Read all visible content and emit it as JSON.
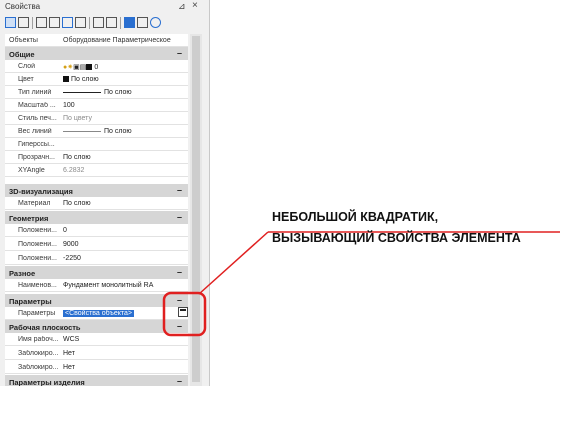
{
  "panel": {
    "title": "Свойства",
    "pin_icon": "pin-icon",
    "close_label": "×",
    "object_row": {
      "key": "Объекты",
      "value": "Оборудование Параметрическое"
    }
  },
  "sections": {
    "general": {
      "title": "Общие",
      "collapse": "–"
    },
    "viz3d": {
      "title": "3D-визуализация",
      "collapse": "–"
    },
    "geometry": {
      "title": "Геометрия",
      "collapse": "–"
    },
    "misc": {
      "title": "Разное",
      "collapse": "–"
    },
    "params": {
      "title": "Параметры",
      "collapse": "–"
    },
    "workplane": {
      "title": "Рабочая плоскость",
      "collapse": "–"
    },
    "product": {
      "title": "Параметры изделия",
      "collapse": "–"
    }
  },
  "general": {
    "layer": {
      "key": "Слой",
      "value": "0"
    },
    "color": {
      "key": "Цвет",
      "value": "По слою"
    },
    "linetype": {
      "key": "Тип линий",
      "value": "По слою"
    },
    "scale": {
      "key": "Масштаб ...",
      "value": "100"
    },
    "plotstyle": {
      "key": "Стиль печ...",
      "value": "По цвету"
    },
    "lineweight": {
      "key": "Вес линий",
      "value": "По слою"
    },
    "hyperlink": {
      "key": "Гиперссы...",
      "value": ""
    },
    "transparency": {
      "key": "Прозрачн...",
      "value": "По слою"
    },
    "xyangle": {
      "key": "XYAngle",
      "value": "6.2832"
    }
  },
  "viz3d": {
    "material": {
      "key": "Материал",
      "value": "По слою"
    }
  },
  "geometry": {
    "posx": {
      "key": "Положени...",
      "value": "0"
    },
    "posy": {
      "key": "Положени...",
      "value": "9000"
    },
    "posz": {
      "key": "Положени...",
      "value": "-2250"
    }
  },
  "misc": {
    "name": {
      "key": "Наименов...",
      "value": "Фундамент монолитный RA"
    }
  },
  "params": {
    "params": {
      "key": "Параметры",
      "value": "<Свойства объекта>"
    }
  },
  "workplane": {
    "name": {
      "key": "Имя рабоч...",
      "value": "WCS"
    },
    "lock1": {
      "key": "Заблокиро...",
      "value": "Нет"
    },
    "lock2": {
      "key": "Заблокиро...",
      "value": "Нет"
    }
  },
  "annotation": {
    "line1": "НЕБОЛЬШОЙ КВАДРАТИК,",
    "line2": "ВЫЗЫВАЮЩИЙ СВОЙСТВА ЭЛЕМЕНТА"
  },
  "colors": {
    "highlight": "#2a6fd0",
    "annotation": "#e02020",
    "section_bg": "#d6d6d6"
  }
}
